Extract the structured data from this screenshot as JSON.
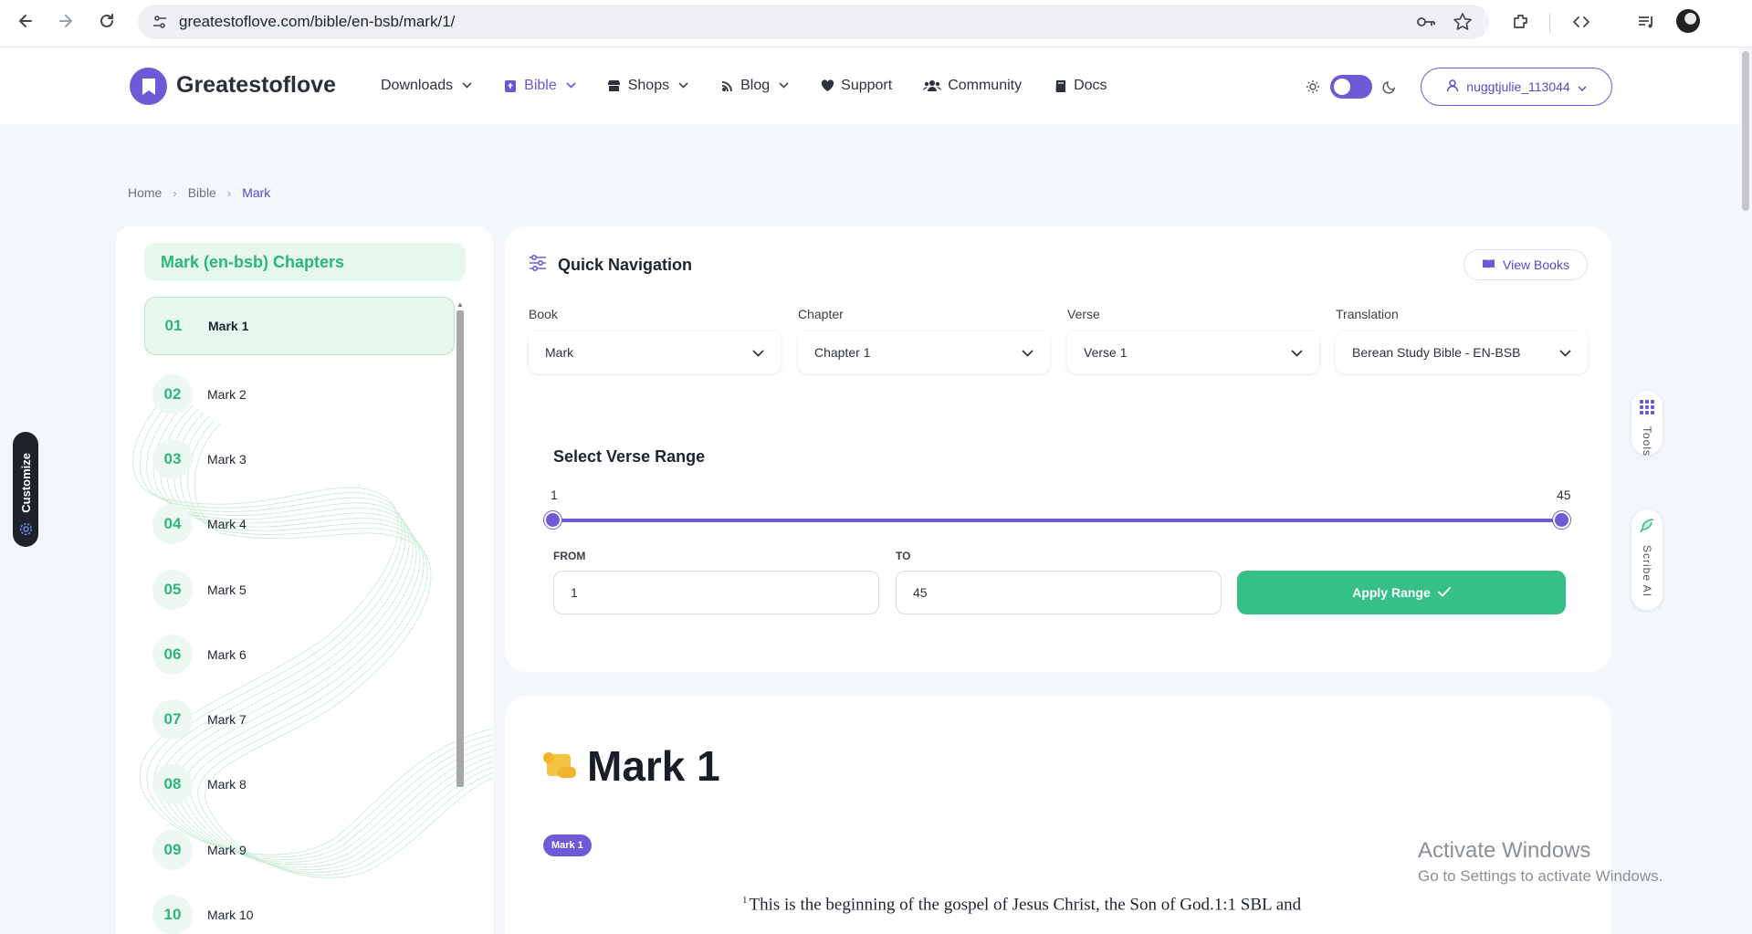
{
  "browser": {
    "url": "greatestoflove.com/bible/en-bsb/mark/1/"
  },
  "header": {
    "logo_text": "Greatestoflove",
    "menu": [
      {
        "label": "Downloads",
        "icon": "none",
        "has_dropdown": true
      },
      {
        "label": "Bible",
        "icon": "bible-icon",
        "has_dropdown": true,
        "active": true
      },
      {
        "label": "Shops",
        "icon": "store-icon",
        "has_dropdown": true
      },
      {
        "label": "Blog",
        "icon": "blog-icon",
        "has_dropdown": true
      },
      {
        "label": "Support",
        "icon": "heart-icon",
        "has_dropdown": false
      },
      {
        "label": "Community",
        "icon": "users-icon",
        "has_dropdown": false
      },
      {
        "label": "Docs",
        "icon": "book-icon",
        "has_dropdown": false
      }
    ],
    "user_label": "nuggtjulie_113044",
    "accent_color": "#6e5ad6"
  },
  "breadcrumb": {
    "items": [
      "Home",
      "Bible",
      "Mark"
    ]
  },
  "customize": {
    "label": "Customize"
  },
  "sidebar": {
    "title": "Mark (en-bsb) Chapters",
    "chapters": [
      {
        "num": "01",
        "label": "Mark 1",
        "active": true
      },
      {
        "num": "02",
        "label": "Mark 2"
      },
      {
        "num": "03",
        "label": "Mark 3"
      },
      {
        "num": "04",
        "label": "Mark 4"
      },
      {
        "num": "05",
        "label": "Mark 5"
      },
      {
        "num": "06",
        "label": "Mark 6"
      },
      {
        "num": "07",
        "label": "Mark 7"
      },
      {
        "num": "08",
        "label": "Mark 8"
      },
      {
        "num": "09",
        "label": "Mark 9"
      },
      {
        "num": "10",
        "label": "Mark 10"
      }
    ],
    "green_color": "#2db67a"
  },
  "quick_nav": {
    "title": "Quick Navigation",
    "view_books_label": "View Books",
    "book": {
      "label": "Book",
      "value": "Mark"
    },
    "chapter": {
      "label": "Chapter",
      "value": "Chapter 1"
    },
    "verse": {
      "label": "Verse",
      "value": "Verse 1"
    },
    "translation": {
      "label": "Translation",
      "value": "Berean Study Bible - EN-BSB"
    },
    "range": {
      "title": "Select Verse Range",
      "min_label": "1",
      "max_label": "45",
      "from_label": "FROM",
      "to_label": "TO",
      "from_value": "1",
      "to_value": "45",
      "apply_label": "Apply Range"
    }
  },
  "content": {
    "chapter_title": "Mark 1",
    "badge": "Mark 1",
    "verse_number": "1",
    "verse_text": "This is the beginning of the gospel of Jesus Christ, the Son of God.1:1 SBL and"
  },
  "side_tabs": {
    "tools_label": "Tools",
    "scribe_label": "Scribe AI"
  },
  "watermark": {
    "title": "Activate Windows",
    "subtitle": "Go to Settings to activate Windows."
  }
}
